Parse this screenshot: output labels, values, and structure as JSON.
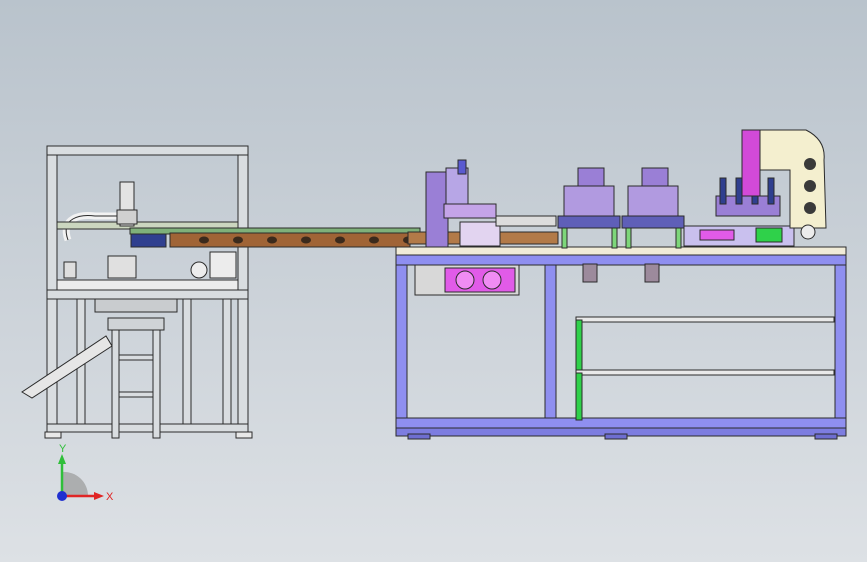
{
  "viewport": {
    "background_top": "#b9c3cc",
    "background_bottom": "#dde1e5"
  },
  "colors": {
    "frame_gray": "#d9dde0",
    "frame_edge": "#2b2b2b",
    "table_blue": "#8f8ff0",
    "conveyor_brown": "#a06436",
    "module_purple": "#9a7fd6",
    "accent_pink": "#e15be8",
    "accent_green": "#2fd14a",
    "bracket_cream": "#f4efcf"
  },
  "triad": {
    "y_label": "Y",
    "x_label": "X",
    "y_color": "#2fbf3a",
    "x_color": "#e02525",
    "z_color": "#2030d0"
  }
}
